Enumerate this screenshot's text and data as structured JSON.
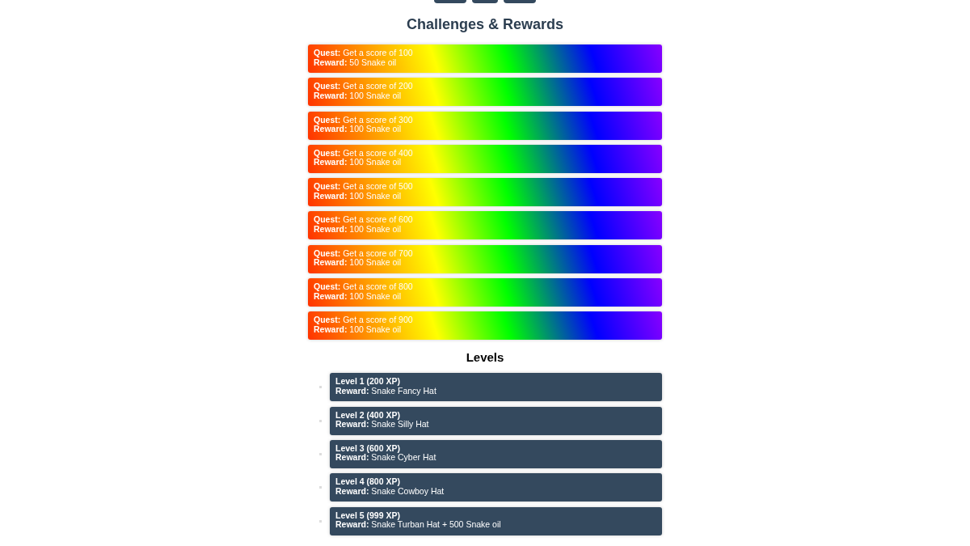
{
  "nav_buttons": [
    {
      "kind": "button"
    },
    {
      "kind": "button"
    },
    {
      "kind": "button"
    }
  ],
  "title": "Challenges & Rewards",
  "quests": [
    {
      "quest": "**Quest:** Get a score of 100",
      "reward": "**Reward:** 50 Snake oil"
    },
    {
      "quest": "**Quest:** Get a score of 200",
      "reward": "**Reward:** 100 Snake oil"
    },
    {
      "quest": "**Quest:** Get a score of 300",
      "reward": "**Reward:** 100 Snake oil"
    },
    {
      "quest": "**Quest:** Get a score of 400",
      "reward": "**Reward:** 100 Snake oil"
    },
    {
      "quest": "**Quest:** Get a score of 500",
      "reward": "**Reward:** 100 Snake oil"
    },
    {
      "quest": "**Quest:** Get a score of 600",
      "reward": "**Reward:** 100 Snake oil"
    },
    {
      "quest": "**Quest:** Get a score of 700",
      "reward": "**Reward:** 100 Snake oil"
    },
    {
      "quest": "**Quest:** Get a score of 800",
      "reward": "**Reward:** 100 Snake oil"
    },
    {
      "quest": "**Quest:** Get a score of 900",
      "reward": "**Reward:** 100 Snake oil"
    }
  ],
  "levels_title": "Levels",
  "levels": [
    {
      "level": "Level 1 (200 XP)",
      "reward": "**Reward:** Snake Fancy Hat"
    },
    {
      "level": "Level 2 (400 XP)",
      "reward": "**Reward:** Snake Silly Hat"
    },
    {
      "level": "Level 3 (600 XP)",
      "reward": "**Reward:** Snake Cyber Hat"
    },
    {
      "level": "Level 4 (800 XP)",
      "reward": "**Reward:** Snake Cowboy Hat"
    },
    {
      "level": "Level 5 (999 XP)",
      "reward": "**Reward:** Snake Turban Hat + 500 Snake oil"
    }
  ]
}
